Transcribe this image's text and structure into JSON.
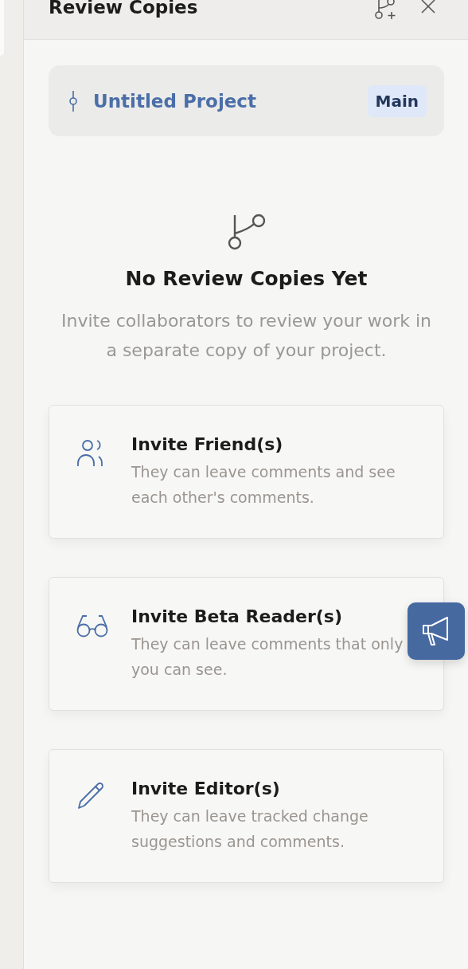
{
  "panel": {
    "title": "Review Copies"
  },
  "project": {
    "name": "Untitled Project",
    "badge": "Main"
  },
  "empty_state": {
    "heading": "No Review Copies Yet",
    "description": "Invite collaborators to review your work in a separate copy of your project."
  },
  "options": [
    {
      "kind": "friends",
      "title": "Invite Friend(s)",
      "description": "They can leave comments and see each other's comments."
    },
    {
      "kind": "beta",
      "title": "Invite Beta Reader(s)",
      "description": "They can leave comments that only you can see."
    },
    {
      "kind": "editor",
      "title": "Invite Editor(s)",
      "description": "They can leave tracked change suggestions and comments."
    }
  ]
}
